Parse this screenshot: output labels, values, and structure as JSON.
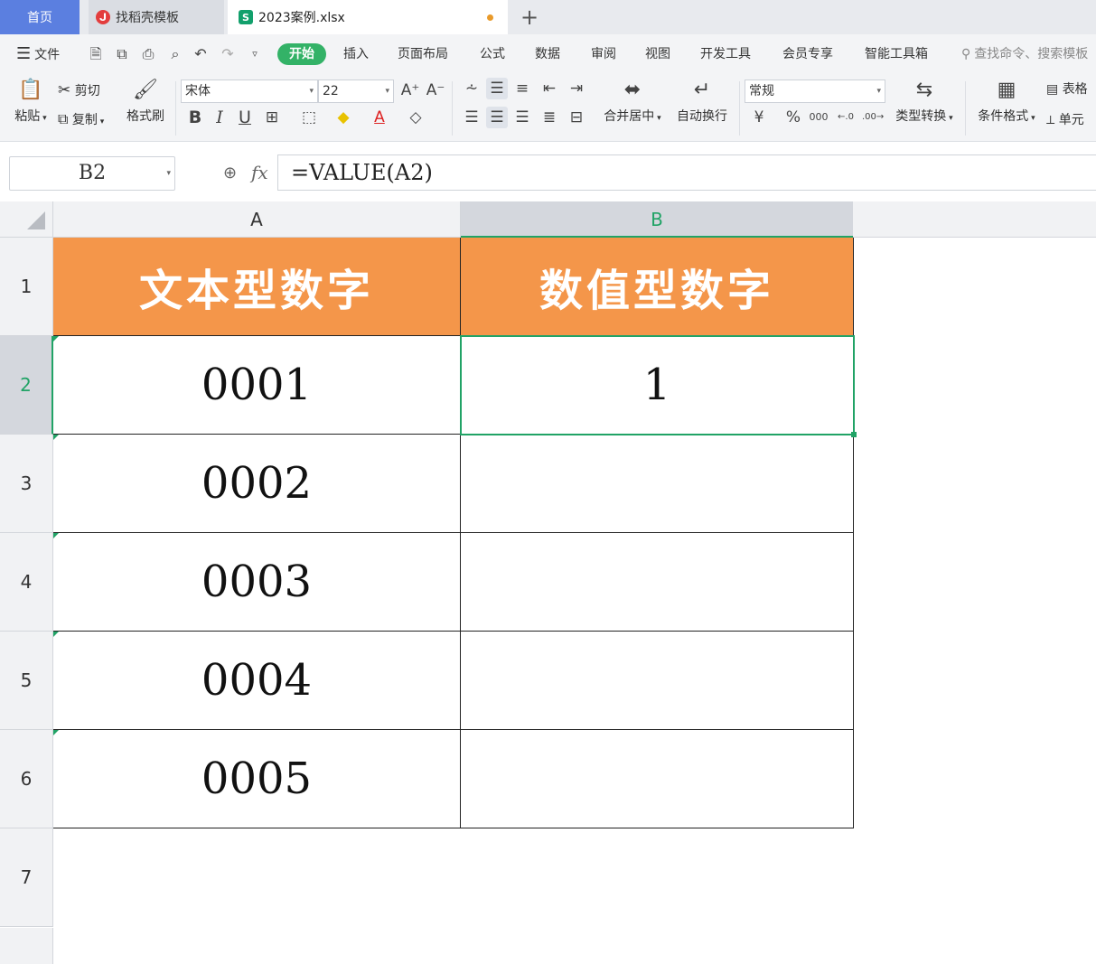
{
  "tabs": {
    "home": "首页",
    "template": "找稻壳模板",
    "file": "2023案例.xlsx",
    "file_icon_letter": "S",
    "add": "+"
  },
  "menu": {
    "file": "文件",
    "items": [
      "开始",
      "插入",
      "页面布局",
      "公式",
      "数据",
      "审阅",
      "视图",
      "开发工具",
      "会员专享",
      "智能工具箱"
    ],
    "search_placeholder": "查找命令、搜索模板"
  },
  "ribbon": {
    "paste": "粘贴",
    "cut": "剪切",
    "copy": "复制",
    "format_painter": "格式刷",
    "font_name": "宋体",
    "font_size": "22",
    "merge_center": "合并居中",
    "wrap_text": "自动换行",
    "number_format": "常规",
    "type_convert": "类型转换",
    "conditional_format": "条件格式",
    "table_style": "表格",
    "cell_style": "单元",
    "currency_symbol": "¥",
    "percent_symbol": "%",
    "thousands_symbol": "000"
  },
  "formula_bar": {
    "name_box": "B2",
    "fx": "fx",
    "formula": "=VALUE(A2)"
  },
  "sheet": {
    "columns": [
      "A",
      "B"
    ],
    "rows": [
      "1",
      "2",
      "3",
      "4",
      "5",
      "6",
      "7"
    ],
    "headers": [
      "文本型数字",
      "数值型数字"
    ],
    "col_a": [
      "0001",
      "0002",
      "0003",
      "0004",
      "0005"
    ],
    "col_b": [
      "1",
      "",
      "",
      "",
      ""
    ],
    "header_fill": "#f4964a",
    "selection_color": "#21a366"
  }
}
